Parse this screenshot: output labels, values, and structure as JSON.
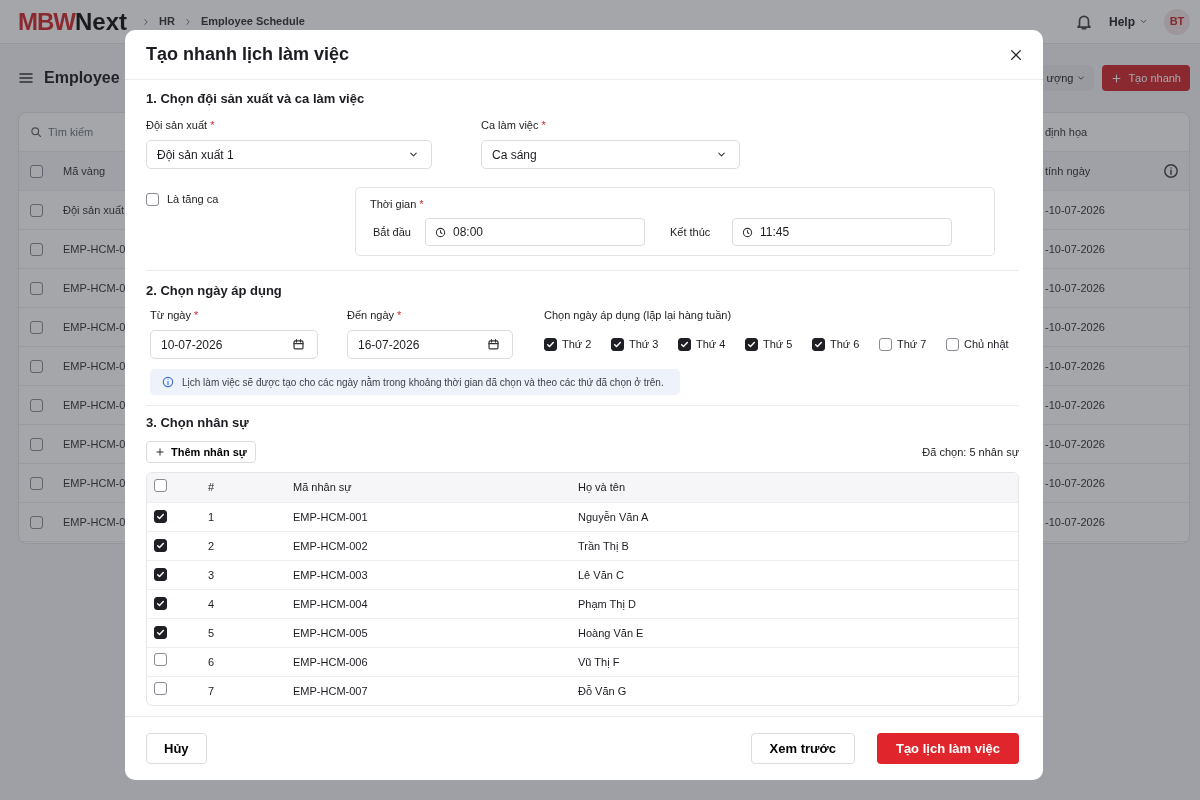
{
  "background": {
    "logo": {
      "part_1": "MBW",
      "part_2": "Next"
    },
    "breadcrumb": [
      "HR",
      "Employee Schedule"
    ],
    "help": "Help",
    "avatar": "BT",
    "page_title": "Employee",
    "filter_dropdown": "ượng",
    "quick_create_button": "Tạo nhanh",
    "search_placeholder": "Tìm kiếm",
    "legend": "định họa",
    "columns": [
      "Mã vàng",
      "tính ngày"
    ],
    "select_all_checked": false,
    "rows": [
      {
        "column_1": "Đội sản xuất",
        "column_2": "-10-07-2026",
        "checked": false
      },
      {
        "column_1": "EMP-HCM-0",
        "column_2": "-10-07-2026",
        "checked": false
      },
      {
        "column_1": "EMP-HCM-0",
        "column_2": "-10-07-2026",
        "checked": false
      },
      {
        "column_1": "EMP-HCM-0",
        "column_2": "-10-07-2026",
        "checked": false
      },
      {
        "column_1": "EMP-HCM-0",
        "column_2": "-10-07-2026",
        "checked": false
      },
      {
        "column_1": "EMP-HCM-0",
        "column_2": "-10-07-2026",
        "checked": false
      },
      {
        "column_1": "EMP-HCM-0",
        "column_2": "-10-07-2026",
        "checked": false
      },
      {
        "column_1": "EMP-HCM-0",
        "column_2": "-10-07-2026",
        "checked": false
      },
      {
        "column_1": "EMP-HCM-0",
        "column_2": "-10-07-2026",
        "checked": false
      }
    ]
  },
  "dialog": {
    "title": "Tạo nhanh lịch làm việc",
    "team_shift": {
      "heading": "1. Chọn đội sản xuất và ca làm việc",
      "team": {
        "label": "Đội sản xuất",
        "mark": "*",
        "value": "Đội sản xuất 1"
      },
      "shift": {
        "label": "Ca làm việc",
        "mark": "*",
        "value": "Ca sáng"
      },
      "overtime": {
        "label": "Là tăng ca",
        "checked": false
      },
      "time": {
        "label": "Thời gian",
        "mark": "*",
        "start_label": "Bắt đầu",
        "start": "08:00",
        "end_label": "Kết thúc",
        "end": "11:45"
      }
    },
    "dates": {
      "heading": "2. Chọn ngày áp dụng",
      "from": {
        "label": "Từ ngày",
        "mark": "*",
        "value": "10-07-2026"
      },
      "to": {
        "label": "Đến ngày",
        "mark": "*",
        "value": "16-07-2026"
      },
      "weekdays_label": "Chọn ngày áp dụng (lặp lại hàng tuần)",
      "weekdays": [
        {
          "label": "Thứ 2",
          "checked": true
        },
        {
          "label": "Thứ 3",
          "checked": true
        },
        {
          "label": "Thứ 4",
          "checked": true
        },
        {
          "label": "Thứ 5",
          "checked": true
        },
        {
          "label": "Thứ 6",
          "checked": true
        },
        {
          "label": "Thứ 7",
          "checked": false
        },
        {
          "label": "Chủ nhật",
          "checked": false
        }
      ],
      "note": "Lịch làm việc sẽ được tạo cho các ngày nằm trong khoảng thời gian đã chọn và theo các thứ đã chọn ở trên."
    },
    "staff": {
      "heading": "3. Chọn nhân sự",
      "add_button": "Thêm nhân sự",
      "selected_count": "Đã chọn: 5 nhân sự",
      "select_all_checked": false,
      "columns": [
        "#",
        "Mã nhân sự",
        "Họ và tên"
      ],
      "rows": [
        {
          "index": "1",
          "code": "EMP-HCM-001",
          "name": "Nguyễn Văn A",
          "checked": true
        },
        {
          "index": "2",
          "code": "EMP-HCM-002",
          "name": "Trần Thị B",
          "checked": true
        },
        {
          "index": "3",
          "code": "EMP-HCM-003",
          "name": "Lê Văn C",
          "checked": true
        },
        {
          "index": "4",
          "code": "EMP-HCM-004",
          "name": "Phạm Thị D",
          "checked": true
        },
        {
          "index": "5",
          "code": "EMP-HCM-005",
          "name": "Hoàng Văn E",
          "checked": true
        },
        {
          "index": "6",
          "code": "EMP-HCM-006",
          "name": "Vũ Thị F",
          "checked": false
        },
        {
          "index": "7",
          "code": "EMP-HCM-007",
          "name": "Đỗ Văn G",
          "checked": false
        }
      ]
    },
    "buttons": {
      "cancel": "Hủy",
      "preview": "Xem trước",
      "submit": "Tạo lịch làm việc"
    }
  }
}
